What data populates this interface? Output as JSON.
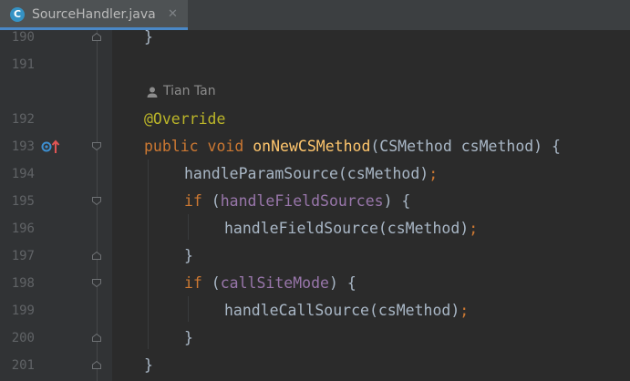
{
  "tab": {
    "icon_letter": "C",
    "title": "SourceHandler.java",
    "close_glyph": "✕",
    "icon_name": "java-class-icon"
  },
  "author_hint": {
    "icon": "person-icon",
    "text": "Tian Tan"
  },
  "colors": {
    "background": "#2b2b2b",
    "gutter": "#313335",
    "keyword": "#cc7832",
    "annotation": "#bbb529",
    "method_decl": "#ffc66d",
    "field": "#9876aa",
    "plain": "#a9b7c6",
    "line_number": "#606366",
    "tab_underline": "#4a88c7"
  },
  "lines": [
    {
      "number": "190",
      "tokens": [
        {
          "text": "}",
          "class": "plain"
        }
      ]
    },
    {
      "number": "191",
      "tokens": []
    },
    {
      "number": "192",
      "tokens": [
        {
          "text": "@Override",
          "class": "ann"
        }
      ]
    },
    {
      "number": "193",
      "tokens": [
        {
          "text": "public",
          "class": "kw"
        },
        {
          "text": " ",
          "class": "plain"
        },
        {
          "text": "void",
          "class": "kw"
        },
        {
          "text": " ",
          "class": "plain"
        },
        {
          "text": "onNewCSMethod",
          "class": "fn"
        },
        {
          "text": "(CSMethod csMethod) {",
          "class": "plain"
        }
      ]
    },
    {
      "number": "194",
      "tokens": [
        {
          "text": "handleParamSource(csMethod)",
          "class": "plain"
        },
        {
          "text": ";",
          "class": "kw"
        }
      ]
    },
    {
      "number": "195",
      "tokens": [
        {
          "text": "if",
          "class": "kw"
        },
        {
          "text": " (",
          "class": "plain"
        },
        {
          "text": "handleFieldSources",
          "class": "fld"
        },
        {
          "text": ") {",
          "class": "plain"
        }
      ]
    },
    {
      "number": "196",
      "tokens": [
        {
          "text": "handleFieldSource(csMethod)",
          "class": "plain"
        },
        {
          "text": ";",
          "class": "kw"
        }
      ]
    },
    {
      "number": "197",
      "tokens": [
        {
          "text": "}",
          "class": "plain"
        }
      ]
    },
    {
      "number": "198",
      "tokens": [
        {
          "text": "if",
          "class": "kw"
        },
        {
          "text": " (",
          "class": "plain"
        },
        {
          "text": "callSiteMode",
          "class": "fld"
        },
        {
          "text": ") {",
          "class": "plain"
        }
      ]
    },
    {
      "number": "199",
      "tokens": [
        {
          "text": "handleCallSource(csMethod)",
          "class": "plain"
        },
        {
          "text": ";",
          "class": "kw"
        }
      ]
    },
    {
      "number": "200",
      "tokens": [
        {
          "text": "}",
          "class": "plain"
        }
      ]
    },
    {
      "number": "201",
      "tokens": [
        {
          "text": "}",
          "class": "plain"
        }
      ]
    }
  ]
}
